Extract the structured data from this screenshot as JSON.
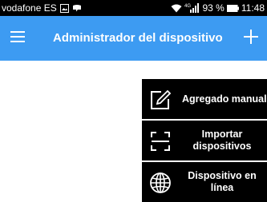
{
  "status_bar": {
    "carrier": "vodafone ES",
    "signal_label": "4G",
    "battery_percent": "93 %",
    "time": "11:48",
    "icons": [
      "gallery-icon",
      "notification-icon",
      "wifi-icon",
      "signal-icon",
      "battery-icon"
    ]
  },
  "app_bar": {
    "title": "Administrador del dispositivo",
    "background": "#3d9bf2",
    "menu_icon": "hamburger-menu-icon",
    "add_icon": "plus-icon"
  },
  "popup_menu": {
    "background": "#000000",
    "items": [
      {
        "label": "Agregado manual",
        "icon": "edit-square-icon"
      },
      {
        "label": "Importar\ndispositivos",
        "icon": "scan-frame-icon"
      },
      {
        "label": "Dispositivo en\nlínea",
        "icon": "globe-icon"
      }
    ]
  }
}
